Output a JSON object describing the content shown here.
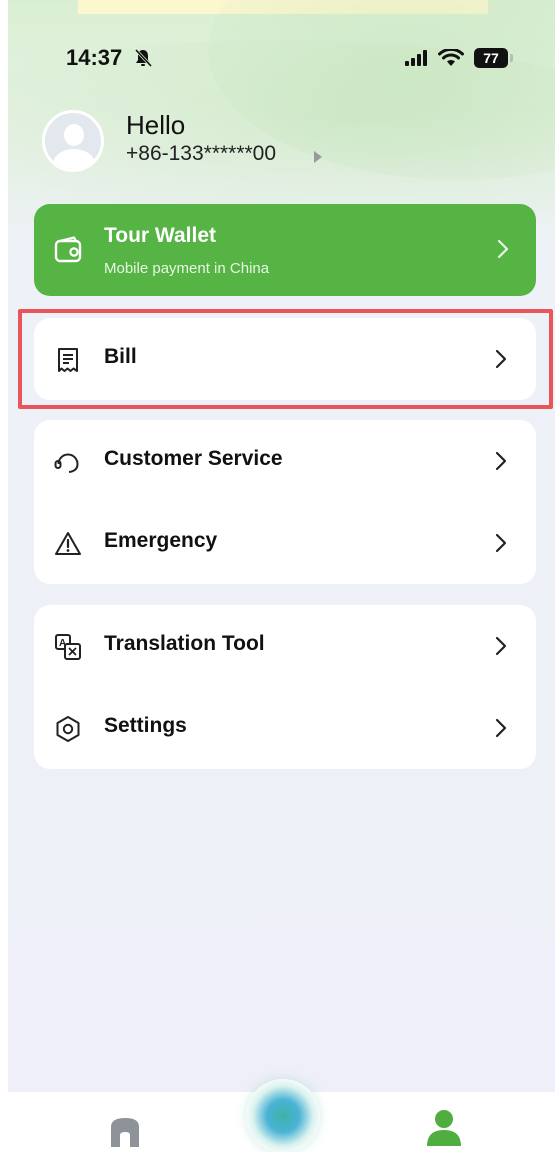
{
  "status_bar": {
    "time": "14:37",
    "battery": "77"
  },
  "profile": {
    "greeting": "Hello",
    "phone": "+86-133******00"
  },
  "wallet": {
    "title": "Tour Wallet",
    "subtitle": "Mobile payment in China",
    "color": "#56b445"
  },
  "menu": {
    "bill": "Bill",
    "customer_service": "Customer Service",
    "emergency": "Emergency",
    "translation_tool": "Translation Tool",
    "settings": "Settings"
  },
  "highlight_color": "#e8565a",
  "tab_bar": {
    "items": [
      "home-icon",
      "assistant-orb-icon",
      "profile-icon"
    ]
  }
}
